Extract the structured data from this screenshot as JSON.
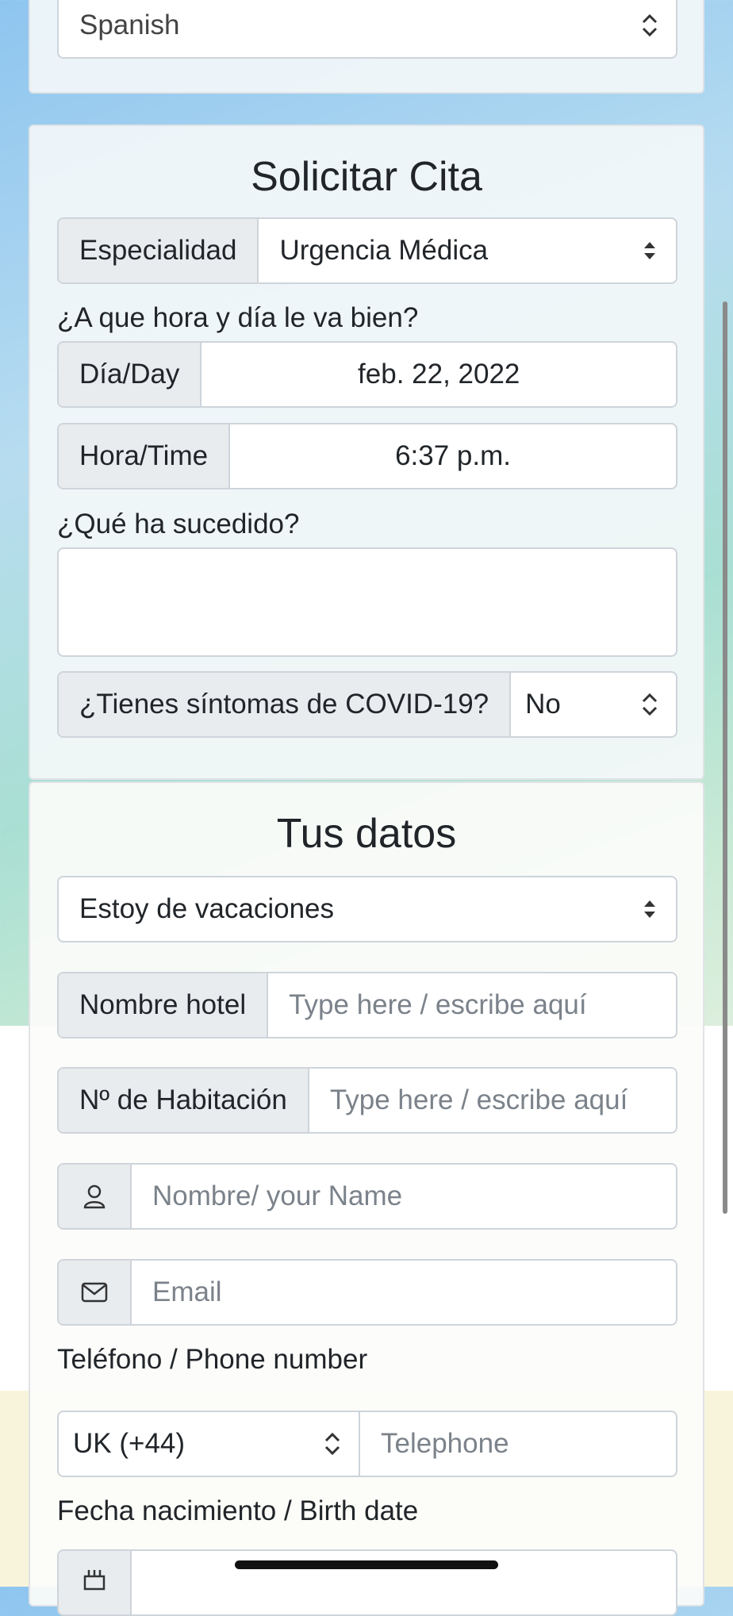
{
  "language_selector": {
    "value": "Spanish"
  },
  "cita": {
    "title": "Solicitar Cita",
    "especialidad": {
      "label": "Especialidad",
      "value": "Urgencia Médica"
    },
    "when_question": "¿A que hora y día le va bien?",
    "day": {
      "label": "Día/Day",
      "value": "feb. 22, 2022"
    },
    "time": {
      "label": "Hora/Time",
      "value": "6:37 p.m."
    },
    "what_happened_label": "¿Qué ha sucedido?",
    "covid": {
      "label": "¿Tienes síntomas de COVID-19?",
      "value": "No"
    }
  },
  "datos": {
    "title": "Tus datos",
    "situation": {
      "value": "Estoy de vacaciones"
    },
    "hotel": {
      "label": "Nombre hotel",
      "placeholder": "Type here / escribe aquí"
    },
    "room": {
      "label": "Nº de Habitación",
      "placeholder": "Type here / escribe aquí"
    },
    "name": {
      "placeholder": "Nombre/ your Name",
      "icon": "person-icon"
    },
    "email": {
      "placeholder": "Email",
      "icon": "envelope-icon"
    },
    "phone_label": "Teléfono / Phone number",
    "country_code": {
      "value": "UK (+44)"
    },
    "telephone": {
      "placeholder": "Telephone"
    },
    "birth_label": "Fecha nacimiento / Birth date",
    "birth_icon": "cake-icon"
  }
}
